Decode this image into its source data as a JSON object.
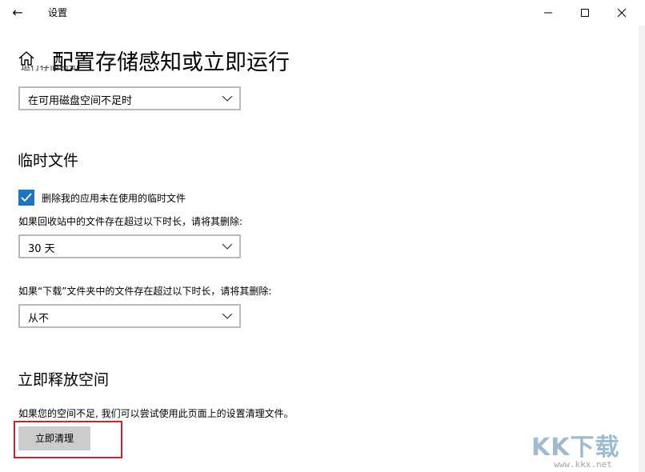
{
  "window": {
    "title": "设置",
    "back_glyph": "←"
  },
  "page": {
    "title": "配置存储感知或立即运行",
    "cutoff_label": "运行存储感知"
  },
  "storage_sense": {
    "run_dropdown_value": "在可用磁盘空间不足时"
  },
  "temp_files": {
    "section_title": "临时文件",
    "checkbox_label": "删除我的应用未在使用的临时文件",
    "checkbox_checked": true,
    "recycle_bin_label": "如果回收站中的文件存在超过以下时长，请将其删除:",
    "recycle_bin_value": "30 天",
    "downloads_label": "如果“下载”文件夹中的文件存在超过以下时长，请将其删除:",
    "downloads_value": "从不"
  },
  "free_space": {
    "section_title": "立即释放空间",
    "description": "如果您的空间不足, 我们可以尝试使用此页面上的设置清理文件。",
    "clean_button_label": "立即清理"
  },
  "watermark": {
    "logo": "KK下载",
    "url": "www.kkx.net"
  },
  "colors": {
    "accent": "#1b74c4",
    "highlight": "#c8232c",
    "button_bg": "#cccccc"
  }
}
